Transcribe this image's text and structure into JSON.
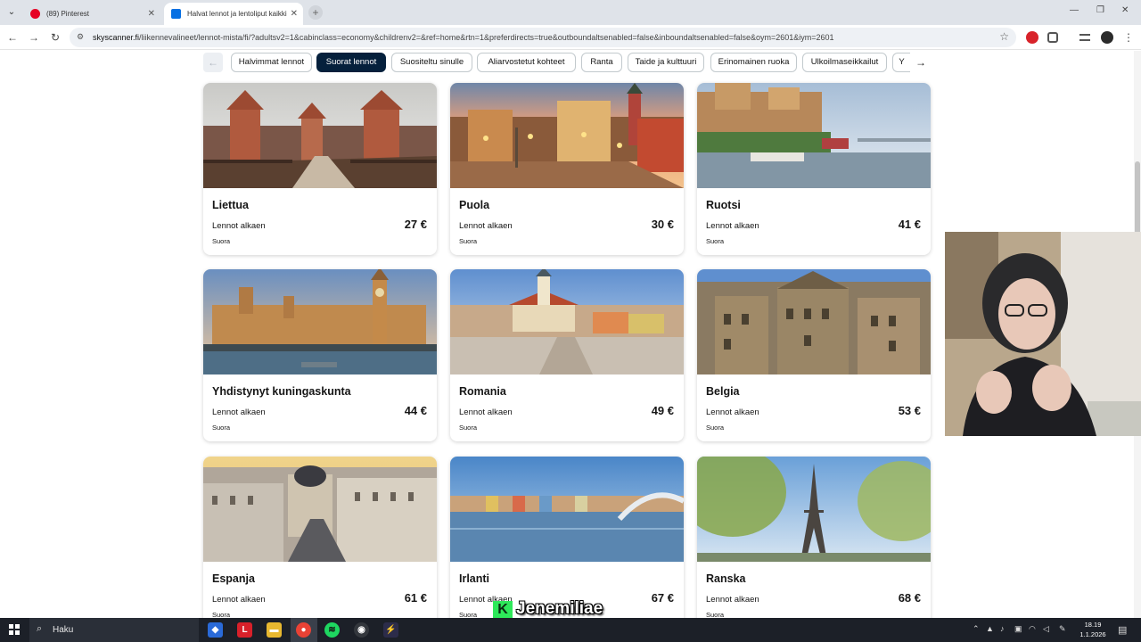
{
  "browser": {
    "tabs": [
      {
        "title": "(89) Pinterest",
        "favicon_color": "#e60023"
      },
      {
        "title": "Halvat lennot ja lentoliput kaikki",
        "favicon_color": "#0770e3"
      }
    ],
    "new_tab_label": "+",
    "url_domain": "skyscanner.fi",
    "url_path": "/liikennevalineet/lennot-mista/fi/?adultsv2=1&cabinclass=economy&childrenv2=&ref=home&rtn=1&preferdirects=true&outboundaltsenabled=false&inboundaltsenabled=false&oym=2601&iym=2601"
  },
  "chips": [
    {
      "label": "Halvimmat lennot",
      "active": false
    },
    {
      "label": "Suorat lennot",
      "active": true
    },
    {
      "label": "Suositeltu sinulle",
      "active": false
    },
    {
      "label": "Aliarvostetut kohteet",
      "active": false
    },
    {
      "label": "Ranta",
      "active": false
    },
    {
      "label": "Taide ja kulttuuri",
      "active": false
    },
    {
      "label": "Erinomainen ruoka",
      "active": false
    },
    {
      "label": "Ulkoilmaseikkailut",
      "active": false
    },
    {
      "label": "Y",
      "active": false
    }
  ],
  "nav_arrows": {
    "left": "←",
    "right": "→"
  },
  "cards": [
    {
      "name": "Liettua",
      "from": "Lennot alkaen",
      "price": "27 €",
      "direct": "Suora"
    },
    {
      "name": "Puola",
      "from": "Lennot alkaen",
      "price": "30 €",
      "direct": "Suora"
    },
    {
      "name": "Ruotsi",
      "from": "Lennot alkaen",
      "price": "41 €",
      "direct": "Suora"
    },
    {
      "name": "Yhdistynyt kuningaskunta",
      "from": "Lennot alkaen",
      "price": "44 €",
      "direct": "Suora"
    },
    {
      "name": "Romania",
      "from": "Lennot alkaen",
      "price": "49 €",
      "direct": "Suora"
    },
    {
      "name": "Belgia",
      "from": "Lennot alkaen",
      "price": "53 €",
      "direct": "Suora"
    },
    {
      "name": "Espanja",
      "from": "Lennot alkaen",
      "price": "61 €",
      "direct": "Suora"
    },
    {
      "name": "Irlanti",
      "from": "Lennot alkaen",
      "price": "67 €",
      "direct": "Suora"
    },
    {
      "name": "Ranska",
      "from": "Lennot alkaen",
      "price": "68 €",
      "direct": "Suora"
    }
  ],
  "watermark": {
    "badge": "K",
    "text": "Jenemiliae"
  },
  "taskbar": {
    "search_placeholder": "Haku",
    "time": "18.19",
    "date": "1.1.2026"
  }
}
